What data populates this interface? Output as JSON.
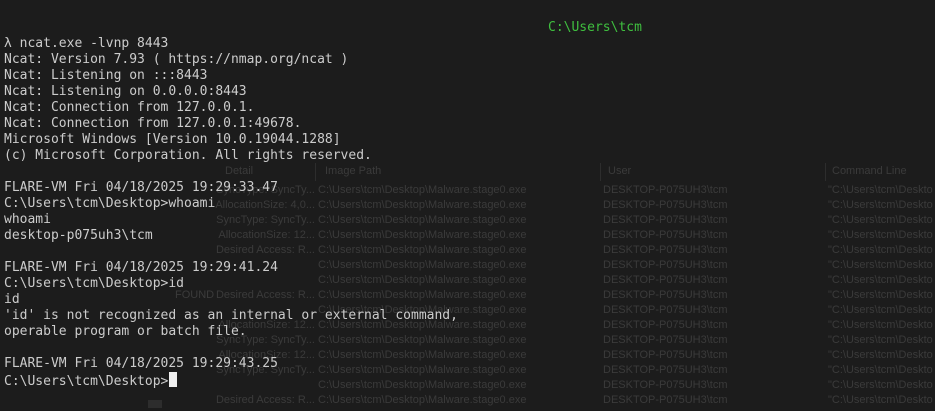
{
  "title_path": "C:\\Users\\tcm",
  "terminal_lines": [
    "λ ncat.exe -lvnp 8443",
    "Ncat: Version 7.93 ( https://nmap.org/ncat )",
    "Ncat: Listening on :::8443",
    "Ncat: Listening on 0.0.0.0:8443",
    "Ncat: Connection from 127.0.0.1.",
    "Ncat: Connection from 127.0.0.1:49678.",
    "Microsoft Windows [Version 10.0.19044.1288]",
    "(c) Microsoft Corporation. All rights reserved.",
    "",
    "FLARE-VM Fri 04/18/2025 19:29:33.47",
    "C:\\Users\\tcm\\Desktop>whoami",
    "whoami",
    "desktop-p075uh3\\tcm",
    "",
    "FLARE-VM Fri 04/18/2025 19:29:41.24",
    "C:\\Users\\tcm\\Desktop>id",
    "id",
    "'id' is not recognized as an internal or external command,",
    "operable program or batch file.",
    "",
    "FLARE-VM Fri 04/18/2025 19:29:43.25"
  ],
  "prompt_line": "C:\\Users\\tcm\\Desktop>",
  "background_window": {
    "headers": {
      "detail": "Detail",
      "image_path": "Image Path",
      "user": "User",
      "command_line": "Command Line"
    },
    "rows": [
      {
        "pre": "",
        "detail": "SyncType: SyncTy...",
        "image": "C:\\Users\\tcm\\Desktop\\Malware.stage0.exe",
        "user": "DESKTOP-P075UH3\\tcm",
        "cmd": "\"C:\\Users\\tcm\\Deskto"
      },
      {
        "pre": "",
        "detail": "AllocationSize: 4,0...",
        "image": "C:\\Users\\tcm\\Desktop\\Malware.stage0.exe",
        "user": "DESKTOP-P075UH3\\tcm",
        "cmd": "\"C:\\Users\\tcm\\Deskto"
      },
      {
        "pre": "",
        "detail": "SyncType: SyncTy...",
        "image": "C:\\Users\\tcm\\Desktop\\Malware.stage0.exe",
        "user": "DESKTOP-P075UH3\\tcm",
        "cmd": "\"C:\\Users\\tcm\\Deskto"
      },
      {
        "pre": "",
        "detail": "AllocationSize: 12...",
        "image": "C:\\Users\\tcm\\Desktop\\Malware.stage0.exe",
        "user": "DESKTOP-P075UH3\\tcm",
        "cmd": "\"C:\\Users\\tcm\\Deskto"
      },
      {
        "pre": "",
        "detail": "Desired Access: R...",
        "image": "C:\\Users\\tcm\\Desktop\\Malware.stage0.exe",
        "user": "DESKTOP-P075UH3\\tcm",
        "cmd": "\"C:\\Users\\tcm\\Deskto"
      },
      {
        "pre": "",
        "detail": "",
        "image": "C:\\Users\\tcm\\Desktop\\Malware.stage0.exe",
        "user": "DESKTOP-P075UH3\\tcm",
        "cmd": "\"C:\\Users\\tcm\\Deskto"
      },
      {
        "pre": "",
        "detail": "",
        "image": "C:\\Users\\tcm\\Desktop\\Malware.stage0.exe",
        "user": "DESKTOP-P075UH3\\tcm",
        "cmd": "\"C:\\Users\\tcm\\Deskto"
      },
      {
        "pre": "FOUND",
        "detail": "Desired Access: R...",
        "image": "C:\\Users\\tcm\\Desktop\\Malware.stage0.exe",
        "user": "DESKTOP-P075UH3\\tcm",
        "cmd": "\"C:\\Users\\tcm\\Deskto"
      },
      {
        "pre": "",
        "detail": "",
        "image": "C:\\Users\\tcm\\Desktop\\Malware.stage0.exe",
        "user": "DESKTOP-P075UH3\\tcm",
        "cmd": "\"C:\\Users\\tcm\\Deskto"
      },
      {
        "pre": "",
        "detail": "AllocationSize: 12...",
        "image": "C:\\Users\\tcm\\Desktop\\Malware.stage0.exe",
        "user": "DESKTOP-P075UH3\\tcm",
        "cmd": "\"C:\\Users\\tcm\\Deskto"
      },
      {
        "pre": "",
        "detail": "SyncType: SyncTy...",
        "image": "C:\\Users\\tcm\\Desktop\\Malware.stage0.exe",
        "user": "DESKTOP-P075UH3\\tcm",
        "cmd": "\"C:\\Users\\tcm\\Deskto"
      },
      {
        "pre": "",
        "detail": "AllocationSize: 12...",
        "image": "C:\\Users\\tcm\\Desktop\\Malware.stage0.exe",
        "user": "DESKTOP-P075UH3\\tcm",
        "cmd": "\"C:\\Users\\tcm\\Deskto"
      },
      {
        "pre": "",
        "detail": "SyncType: SyncTy...",
        "image": "C:\\Users\\tcm\\Desktop\\Malware.stage0.exe",
        "user": "DESKTOP-P075UH3\\tcm",
        "cmd": "\"C:\\Users\\tcm\\Deskto"
      },
      {
        "pre": "",
        "detail": "",
        "image": "C:\\Users\\tcm\\Desktop\\Malware.stage0.exe",
        "user": "DESKTOP-P075UH3\\tcm",
        "cmd": "\"C:\\Users\\tcm\\Deskto"
      },
      {
        "pre": "",
        "detail": "Desired Access: R...",
        "image": "C:\\Users\\tcm\\Desktop\\Malware.stage0.exe",
        "user": "DESKTOP-P075UH3\\tcm",
        "cmd": "\"C:\\Users\\tcm\\Deskto"
      }
    ]
  },
  "colors": {
    "background": "#1c1c1c",
    "text": "#cccccc",
    "title": "#3fbf3f",
    "cursor": "#f0f0f0"
  }
}
